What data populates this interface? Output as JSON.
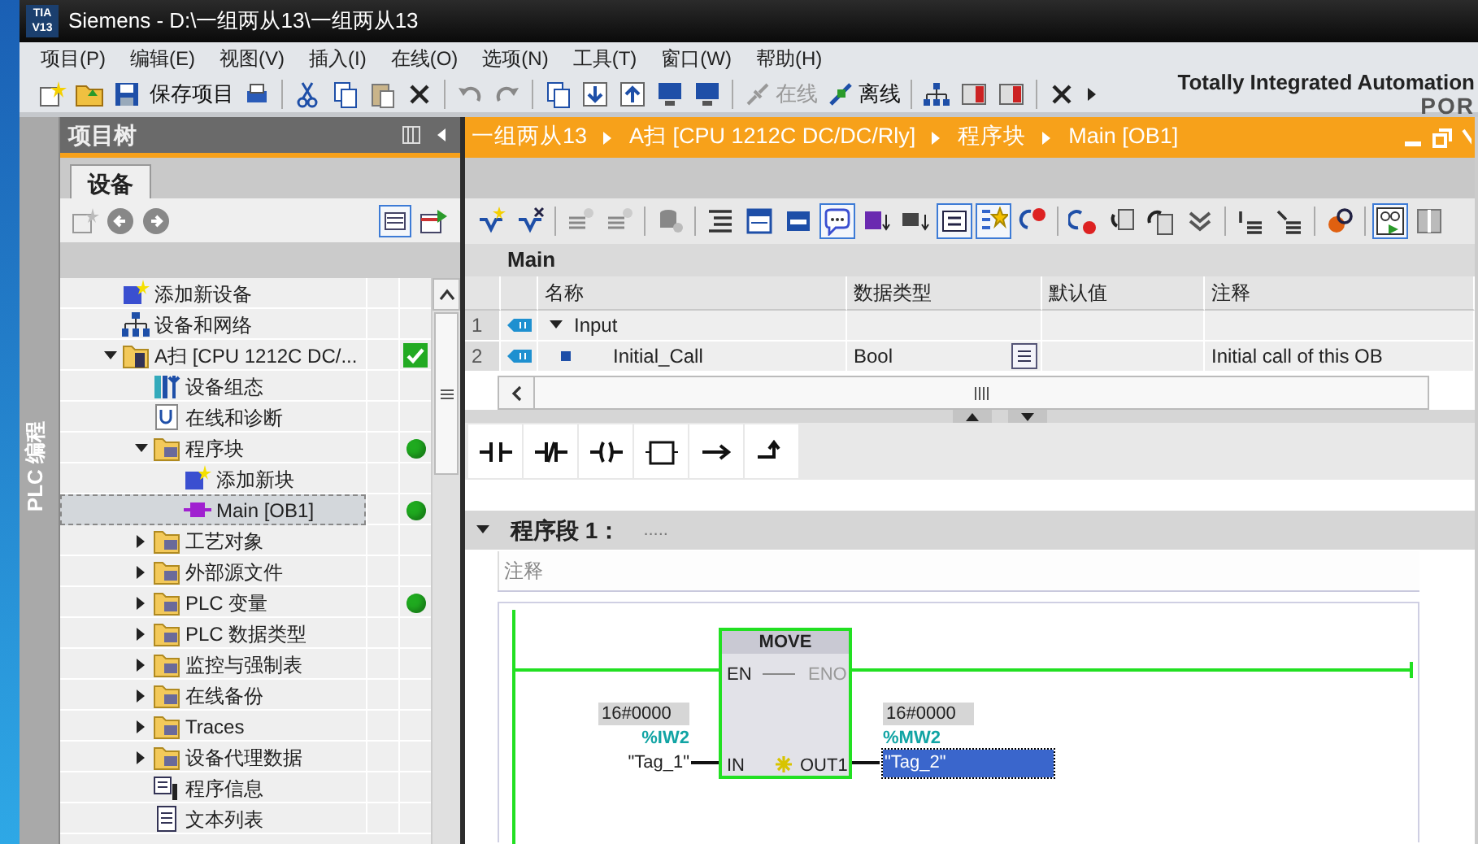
{
  "window": {
    "logo_top": "TIA",
    "logo_bottom": "V13",
    "title": "Siemens  -  D:\\一组两从13\\一组两从13"
  },
  "menu": [
    "项目(P)",
    "编辑(E)",
    "视图(V)",
    "插入(I)",
    "在线(O)",
    "选项(N)",
    "工具(T)",
    "窗口(W)",
    "帮助(H)"
  ],
  "toolbar": {
    "save_label": "保存项目",
    "online_label": "在线",
    "online_disabled": true,
    "offline_label": "离线"
  },
  "brand": {
    "line1": "Totally Integrated Automation",
    "line2": "POR"
  },
  "side_tab": "PLC 编程",
  "project_tree": {
    "title": "项目树",
    "tab": "设备",
    "items": [
      {
        "kind": "add",
        "label": "添加新设备",
        "selected": false
      },
      {
        "kind": "network",
        "label": "设备和网络",
        "selected": false
      },
      {
        "kind": "device",
        "label": "A扫 [CPU 1212C DC/...",
        "selected": false,
        "expanded": true,
        "checked": true,
        "children": [
          {
            "kind": "config",
            "label": "设备组态",
            "selected": false
          },
          {
            "kind": "diag",
            "label": "在线和诊断",
            "selected": false
          },
          {
            "kind": "folder",
            "label": "程序块",
            "selected": false,
            "expanded": true,
            "compiled": true,
            "children": [
              {
                "kind": "add",
                "label": "添加新块",
                "selected": false
              },
              {
                "kind": "block",
                "label": "Main [OB1]",
                "selected": true,
                "compiled": true
              }
            ]
          },
          {
            "kind": "folder",
            "label": "工艺对象",
            "selected": false,
            "expanded": false
          },
          {
            "kind": "folder",
            "label": "外部源文件",
            "selected": false,
            "expanded": false
          },
          {
            "kind": "folder",
            "label": "PLC 变量",
            "selected": false,
            "expanded": false,
            "compiled": true
          },
          {
            "kind": "folder",
            "label": "PLC 数据类型",
            "selected": false,
            "expanded": false
          },
          {
            "kind": "folder",
            "label": "监控与强制表",
            "selected": false,
            "expanded": false
          },
          {
            "kind": "folder",
            "label": "在线备份",
            "selected": false,
            "expanded": false
          },
          {
            "kind": "folder",
            "label": "Traces",
            "selected": false,
            "expanded": false
          },
          {
            "kind": "folder",
            "label": "设备代理数据",
            "selected": false,
            "expanded": false
          },
          {
            "kind": "info",
            "label": "程序信息",
            "selected": false
          },
          {
            "kind": "list",
            "label": "文本列表",
            "selected": false
          }
        ]
      }
    ]
  },
  "breadcrumb": [
    "一组两从13",
    "A扫 [CPU 1212C DC/DC/Rly]",
    "程序块",
    "Main [OB1]"
  ],
  "block_toolbar": [
    {
      "pressed": false
    },
    {
      "pressed": false
    },
    {
      "pressed": false
    },
    {
      "pressed": false
    },
    {
      "pressed": false
    },
    {
      "pressed": false
    },
    {
      "pressed": false
    },
    {
      "pressed": false
    },
    {
      "pressed": true
    },
    {
      "pressed": false
    },
    {
      "pressed": false
    },
    {
      "pressed": true
    },
    {
      "pressed": true
    },
    {
      "pressed": false
    },
    {
      "pressed": false
    },
    {
      "pressed": false
    },
    {
      "pressed": false
    },
    {
      "pressed": false
    },
    {
      "pressed": false
    },
    {
      "pressed": false
    },
    {
      "pressed": false
    },
    {
      "pressed": true
    },
    {
      "pressed": false
    }
  ],
  "interface": {
    "title": "Main",
    "columns": [
      "名称",
      "数据类型",
      "默认值",
      "注释"
    ],
    "rows": [
      {
        "number": "1",
        "name": "Input",
        "expanded": true,
        "children": [
          {
            "number": "2",
            "name": "Initial_Call",
            "data_type": "Bool",
            "comment": "Initial call of this OB"
          }
        ]
      }
    ]
  },
  "network": {
    "title": "程序段 1：",
    "title_comment": ".....",
    "comment": "注释",
    "expanded": true,
    "energized": true,
    "box": {
      "name": "MOVE",
      "en": "EN",
      "eno": "ENO",
      "eno_disabled": true,
      "in": "IN",
      "out": "OUT1"
    },
    "input": {
      "value": "16#0000",
      "address": "%IW2",
      "tag": "\"Tag_1\""
    },
    "output": {
      "value": "16#0000",
      "address": "%MW2",
      "tag": "\"Tag_2\"",
      "selected": true
    }
  }
}
